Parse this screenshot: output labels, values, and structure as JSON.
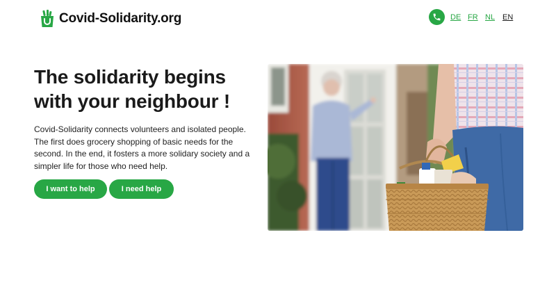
{
  "header": {
    "brand": "Covid-Solidarity.org",
    "languages": [
      "DE",
      "FR",
      "NL",
      "EN"
    ],
    "active_language": "EN",
    "phone_icon": "phone-icon"
  },
  "hero": {
    "title": "The solidarity begins with your neighbour !",
    "description": "Covid-Solidarity connects volunteers and isolated people. The first does grocery shopping of basic needs for the second. In the end, it fosters a more solidary society and a simpler life for those who need help.",
    "buttons": {
      "want_to_help": "I want to help",
      "need_help": "I need help"
    }
  },
  "colors": {
    "accent": "#28a745",
    "text": "#1a1a1a",
    "background": "#ffffff"
  }
}
